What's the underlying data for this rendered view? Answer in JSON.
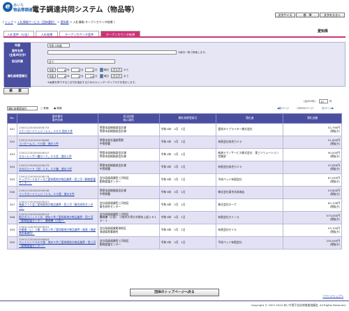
{
  "header": {
    "logo_line1": "あいち",
    "logo_line2": "物品等調達",
    "title": "電子調達共同システム（物品等）",
    "buttons": [
      "文字サイズ",
      "標　準",
      "文字を大きく"
    ]
  },
  "breadcrumb": [
    "トップ",
    "入札情報サービス（団体選択）",
    "愛知県",
    "入札情報-オープンカウンタ結果"
  ],
  "tabs": [
    "入札案件（公告）",
    "入札結果",
    "オープンカウンタ案件",
    "オープンカウンタ結果"
  ],
  "prefecture": "愛知県",
  "form": {
    "year_label": "年度",
    "year_value": "令和 5年度",
    "name_label": "案件名称\n（全角30文字）",
    "name_note": "※部分一致で検索します。",
    "location_label": "担当所属",
    "location_value": "全て",
    "date_label": "開札結果登録日",
    "date_row1": {
      "era": "令和",
      "y": "6",
      "m": "2",
      "d": "1",
      "suffix_y": "年",
      "suffix_m": "月",
      "suffix_d": "日",
      "btn": "曜日",
      "clear": "クリア",
      "tail": "から"
    },
    "date_row2": {
      "era": "令和",
      "y": "6",
      "m": "2",
      "d": "29",
      "suffix_y": "年",
      "suffix_m": "月",
      "suffix_d": "日",
      "btn": "曜日",
      "clear": "クリア",
      "tail": "まで"
    },
    "date_note": "※画像を押下すると日付を指定するためのカレンダーダイアログを表示します。",
    "search_button": "検　索"
  },
  "list": {
    "sort_value": "開札結果登録日",
    "asc": "昇順",
    "desc": "降順",
    "total": "(全492件)",
    "per_page": "10",
    "per_page_suffix": "件",
    "prev": "前ページ",
    "pageinfo": "（35/50ページ）",
    "next": "次ページ"
  },
  "table": {
    "headers": [
      "No.",
      "案件番号\n案件名称",
      "担当所属\n納入場所",
      "開札結果登録日",
      "落札者",
      "落札金額"
    ],
    "rows": [
      {
        "no": "341",
        "id": "230012200000008733",
        "name": "トナーカートリッジ（１１，０００ 他の４件",
        "dept": "警察本部総務部会計課",
        "place": "警察本部総務部会計課",
        "date": "令和 6年　2月　1日",
        "winner": "愛知タイプライター株式会社",
        "amount": "52,790円",
        "sub": "(税抜き)"
      },
      {
        "no": "342",
        "id": "230012200000008666",
        "name": "コンピーム３，００個　他の１件",
        "dept": "警察本部交通部警察",
        "place": "中警察署",
        "date": "令和 6年　2月　1日",
        "winner": "有限会社成合カメラ",
        "amount": "51,600円",
        "sub": "(税抜き)"
      },
      {
        "no": "343",
        "id": "230012200000008547",
        "name": "カラーレーザー機カード，００台　他の１件",
        "dept": "警察本部総務部会計課",
        "place": "警察本部総務部会計課",
        "date": "令和 6年　2月　1日",
        "winner": "新扇テクノサービス株式会社　東三ソリューション営業部",
        "amount": "90,000円",
        "sub": "(税抜き)"
      },
      {
        "no": "344",
        "id": "230012200000008079",
        "name": "ＤＮＧシート（白）１５，００箱　他の２件",
        "dept": "警察本部総務部会計課",
        "place": "中警察署",
        "date": "令和 6年　2月　1日",
        "winner": "有限会社成合カメラ",
        "amount": "47,850円",
        "sub": "(税抜き)"
      },
      {
        "no": "345",
        "id": "230012200000008079",
        "name": "ドッグフード＆ケースご愛知県地方物品業界・西三河（動物愛護センター）",
        "dept": "会計局調達課西三河地区",
        "place": "動物愛護センター",
        "date": "令和 6年　2月　1日",
        "winner": "平成ペット有限会社",
        "amount": "67,555円",
        "sub": "(税抜き)"
      },
      {
        "no": "346",
        "id": "230012200000008048",
        "name": "インクカートリッジ（１５，００個　他の８件",
        "dept": "警察本部総務部会計課",
        "place": "中警察署",
        "date": "令和 6年　2月　1日",
        "winner": "株式会社東京文具商店",
        "amount": "53,800円",
        "sub": "(税抜き)"
      },
      {
        "no": "347",
        "id": "230012200000009021",
        "name": "報道さうり会ご愛知県地方物品業界・西三河（衛生研究センター）",
        "dept": "会計局調達課西三河地区",
        "place": "衛生研究センター",
        "date": "令和 6年　2月　1日",
        "winner": "株式会社ホーク",
        "amount": "82,126円",
        "sub": "(税抜き)"
      },
      {
        "no": "348",
        "id": "230012200000009019",
        "name": "組立式ユニット１式　他の２件ご愛知県地方物品業界・西三河（動物愛護センター　機械棟（小型））",
        "dept": "会計局調達課西三河地区",
        "place": "機械棟（小型）　小牧市大草大字野本上坂１８１８－１",
        "date": "令和 6年　2月　1日",
        "winner": "有限会社カイノス",
        "amount": "573,000円",
        "sub": "(税抜き)"
      },
      {
        "no": "349",
        "id": "230012200000009010",
        "name": "作業服（上）３着　他の２件ご愛知県地方物品業界・尾張（海部県税事務所）",
        "dept": "会計局調達課尾張地区",
        "place": "海部県税事務所",
        "date": "令和 6年　2月　1日",
        "winner": "有限会社セイル",
        "amount": "53,700円",
        "sub": "(税抜き)"
      },
      {
        "no": "350",
        "id": "230012200000008604",
        "name": "ペットシーツ４８０枚　他の２件ご愛知県地方物品業界・西三河（動物愛護センター）",
        "dept": "会計局調達課西三河地区",
        "place": "動物愛護センター",
        "date": "令和 6年　2月　1日",
        "winner": "平成ペット有限会社",
        "amount": "234,000円",
        "sub": "(税抜き)"
      }
    ]
  },
  "footer": {
    "top_button": "団体のトップページへ戻る",
    "page_top": "↑ページトップへ",
    "copyright": "Copyright © 2007-2024 あいち電子自治体推進協議会, All Rights Reserved."
  }
}
